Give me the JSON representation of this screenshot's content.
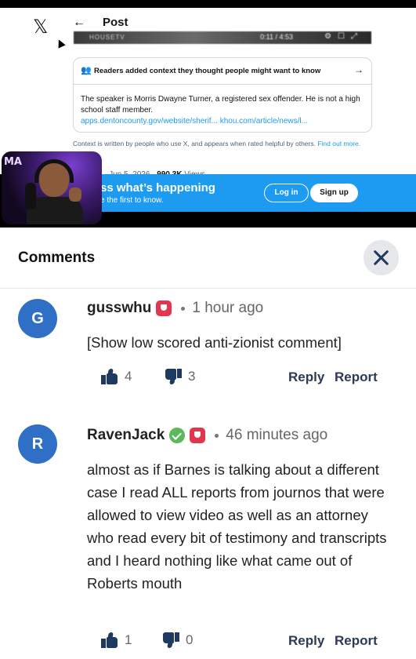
{
  "embed": {
    "post_title": "Post",
    "video": {
      "channel": "HOUSETV",
      "time": "0:11 / 4:53"
    },
    "note": {
      "title": "Readers added context they thought people might want to know",
      "body": "The speaker is Morris Dwayne Turner, a registered sex offender. He is not a high school staff member.",
      "link": "apps.dentoncounty.gov/website/sherif... khou.com/article/news/l..."
    },
    "context": {
      "text": "Context is written by people who use X, and appears when rated helpful by others.",
      "link": "Find out more."
    },
    "meta": {
      "date": "· Jun 5, 2026 ·",
      "views": "990.3K",
      "views_label": "Views"
    },
    "banner": {
      "title": "ss what’s happening",
      "subtitle": "e the first to know.",
      "login": "Log in",
      "signup": "Sign up"
    },
    "webcam_sign": "MA"
  },
  "comments_panel": {
    "title": "Comments",
    "close_icon": "close-icon",
    "items": [
      {
        "avatar": "G",
        "username": "gusswhu",
        "time": "1 hour ago",
        "text": "[Show low scored anti-zionist comment]",
        "likes": "4",
        "dislikes": "3",
        "reply": "Reply",
        "report": "Report"
      },
      {
        "avatar": "R",
        "username": "RavenJack",
        "time": "46 minutes ago",
        "text": "almost as if Barnes is talking about a different case I read ALL reports from journos that were allowed to view video as well as an attorney who read every bit of testimony and transcripts and I heard nothing like what came out of Roberts mouth",
        "likes": "1",
        "dislikes": "0",
        "reply": "Reply",
        "report": "Report"
      }
    ]
  },
  "colors": {
    "accent": "#1d9bf0",
    "avatar": "#2f6fc6",
    "action_text": "#2b3a55",
    "badge_red": "#e0374f",
    "badge_green": "#5cb85c"
  }
}
